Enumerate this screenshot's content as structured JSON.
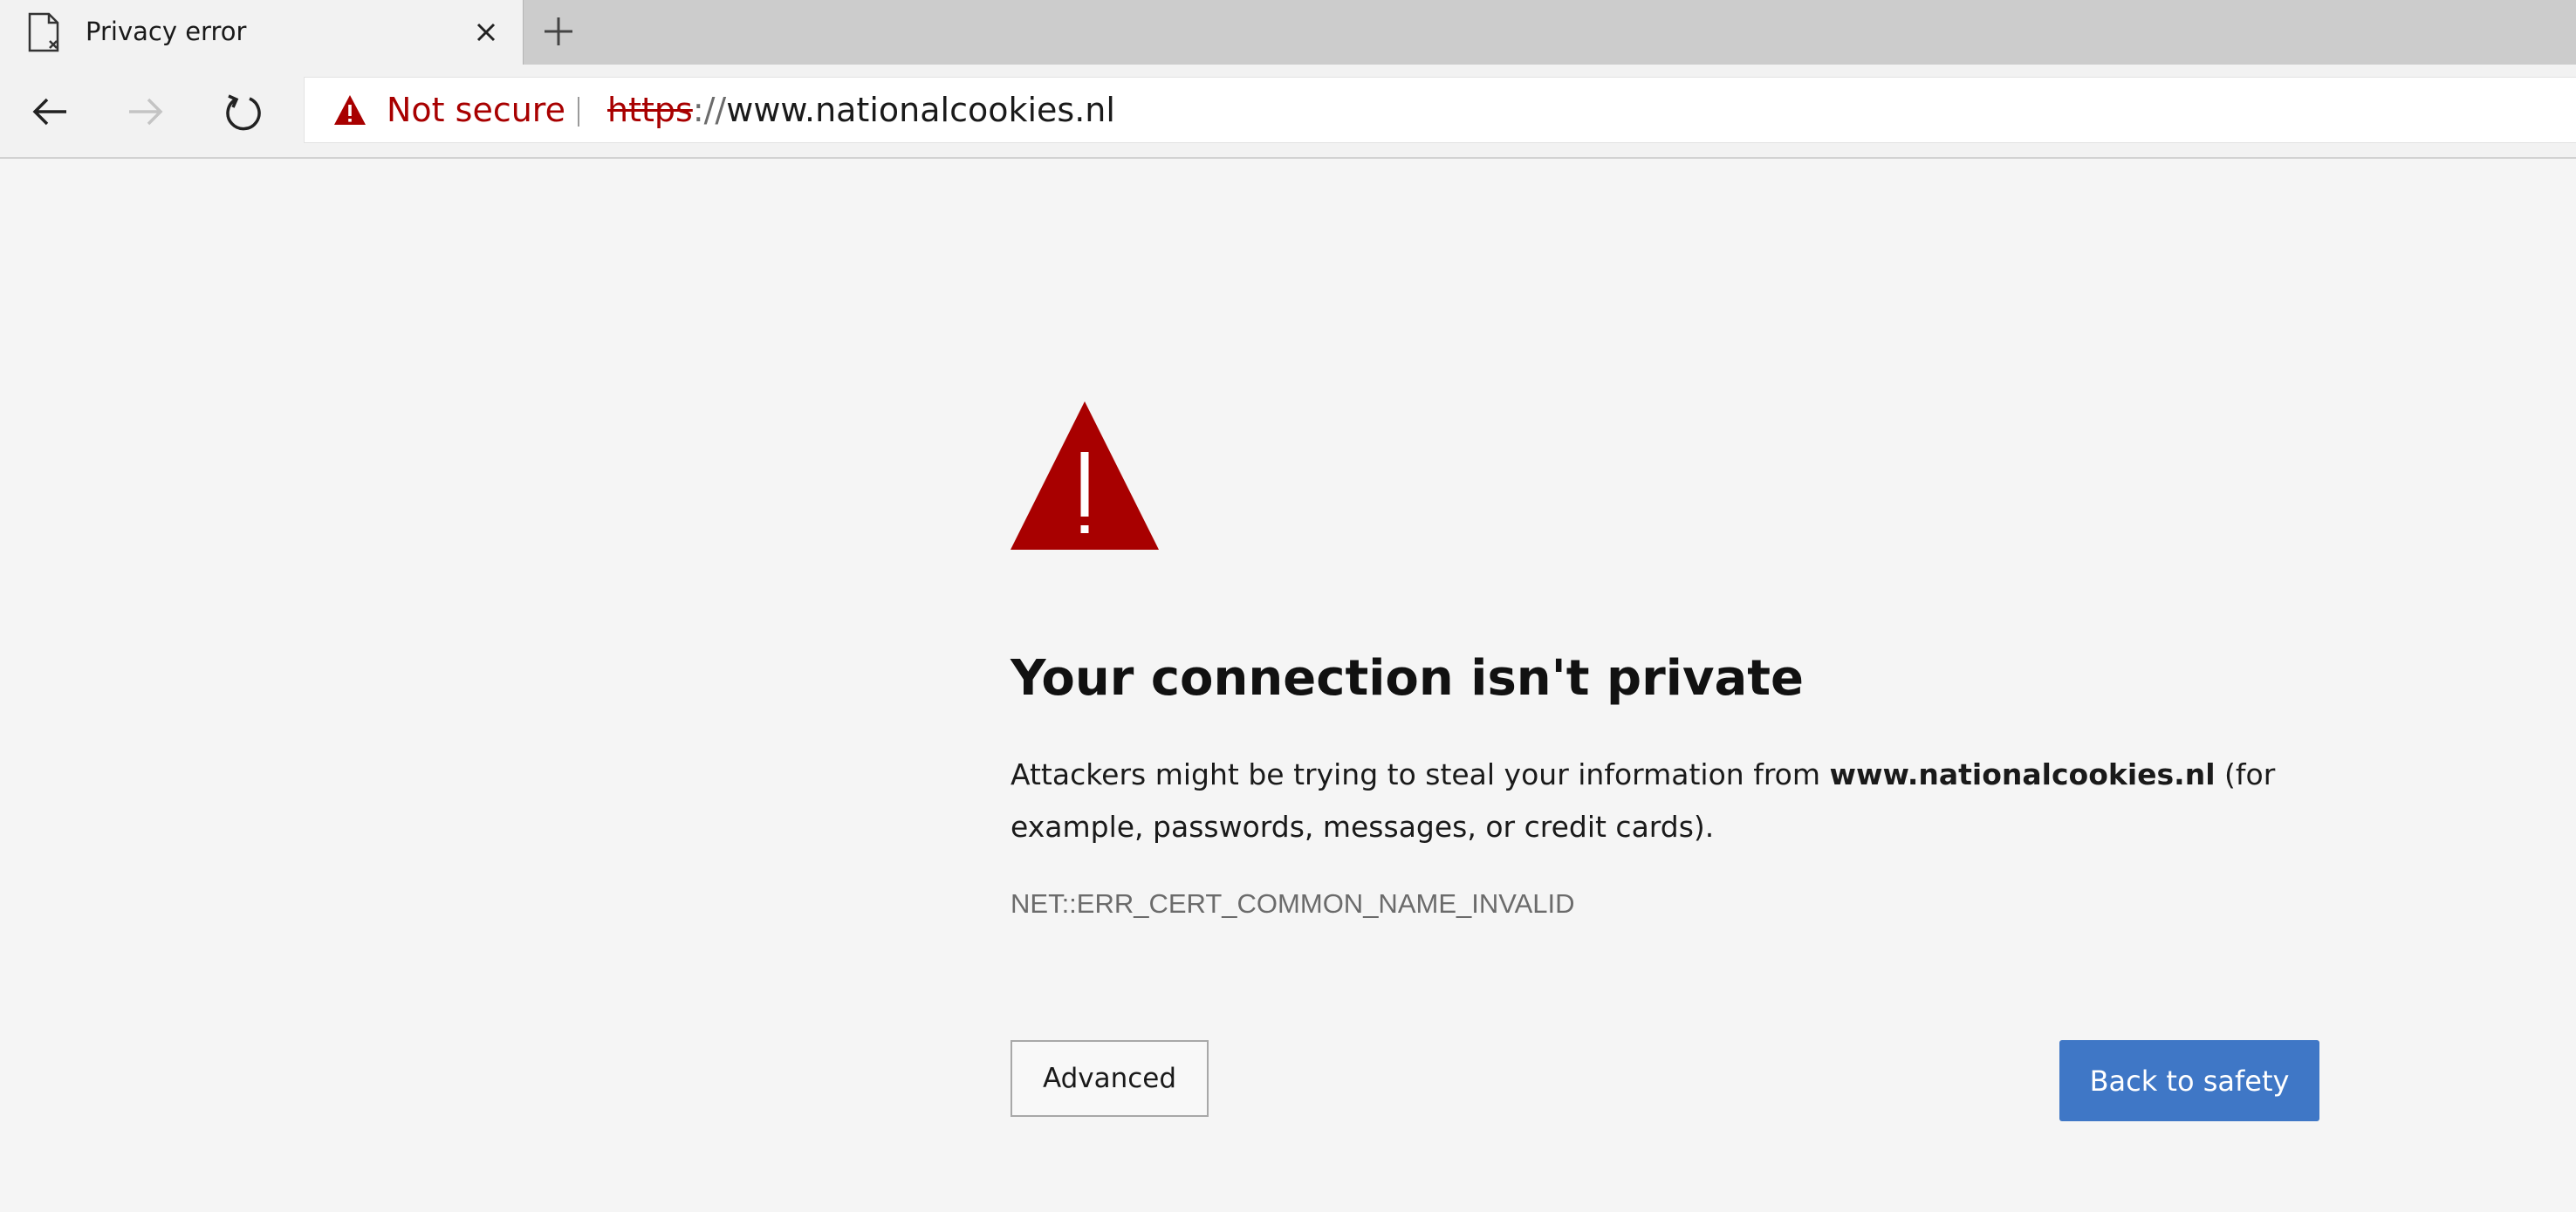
{
  "tab": {
    "title": "Privacy error",
    "page_icon": "page-error-icon",
    "close_icon": "close-icon"
  },
  "tabstrip": {
    "new_tab_icon": "plus-icon"
  },
  "toolbar": {
    "back_icon": "arrow-left-icon",
    "forward_icon": "arrow-right-icon",
    "refresh_icon": "refresh-icon"
  },
  "address_bar": {
    "security_label": "Not secure",
    "security_icon": "warning-triangle-icon",
    "url_scheme": "https",
    "url_separator": "://",
    "url_host": "www.nationalcookies.nl"
  },
  "content": {
    "warning_icon": "warning-triangle-icon",
    "heading": "Your connection isn't private",
    "description_before": "Attackers might be trying to steal your information from ",
    "description_host": "www.nationalcookies.nl",
    "description_after": " (for example, passwords, messages, or credit cards).",
    "error_code": "NET::ERR_CERT_COMMON_NAME_INVALID",
    "advanced_label": "Advanced",
    "back_label": "Back to safety"
  },
  "colors": {
    "warning_red": "#a80000",
    "primary_button": "#3f77c6",
    "page_background": "#f5f5f5"
  }
}
